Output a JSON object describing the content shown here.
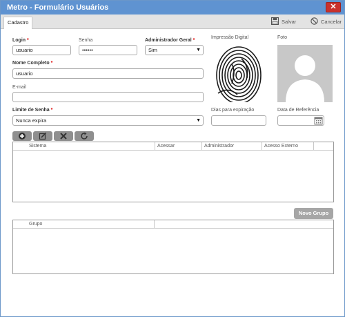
{
  "window": {
    "title": "Metro - Formulário Usuários",
    "close_glyph": "✕"
  },
  "toolbar": {
    "tab_label": "Cadastro",
    "save_label": "Salvar",
    "cancel_label": "Cancelar"
  },
  "form": {
    "login": {
      "label": "Login",
      "required": "*",
      "value": "usuario"
    },
    "senha": {
      "label": "Senha",
      "value": "••••••"
    },
    "admin_geral": {
      "label": "Administrador Geral",
      "required": "*",
      "value": "Sim"
    },
    "nome_completo": {
      "label": "Nome Completo",
      "required": "*",
      "value": "usuario"
    },
    "email": {
      "label": "E-mail",
      "value": ""
    },
    "limite_senha": {
      "label": "Limite de Senha",
      "required": "*",
      "value": "Nunca expira"
    },
    "impressao_digital": {
      "label": "Impressão Digital"
    },
    "foto": {
      "label": "Foto"
    },
    "dias_expiracao": {
      "label": "Dias para expiração",
      "value": ""
    },
    "data_referencia": {
      "label": "Data de Referência",
      "value": ""
    }
  },
  "icons": {
    "add": "add-icon",
    "edit": "edit-icon",
    "delete": "delete-icon",
    "refresh": "refresh-icon",
    "save": "floppy-disk-icon",
    "cancel": "cancel-icon",
    "calendar": "calendar-icon"
  },
  "systems_grid": {
    "columns": [
      "Sistema",
      "Acessar",
      "Administrador",
      "Acesso Externo"
    ]
  },
  "groups": {
    "new_button": "Novo Grupo",
    "columns": [
      "Grupo"
    ]
  },
  "colors": {
    "titlebar": "#5f93d1",
    "close": "#c9302c",
    "required": "#dd0000",
    "icon_button": "#8f8f8f"
  }
}
